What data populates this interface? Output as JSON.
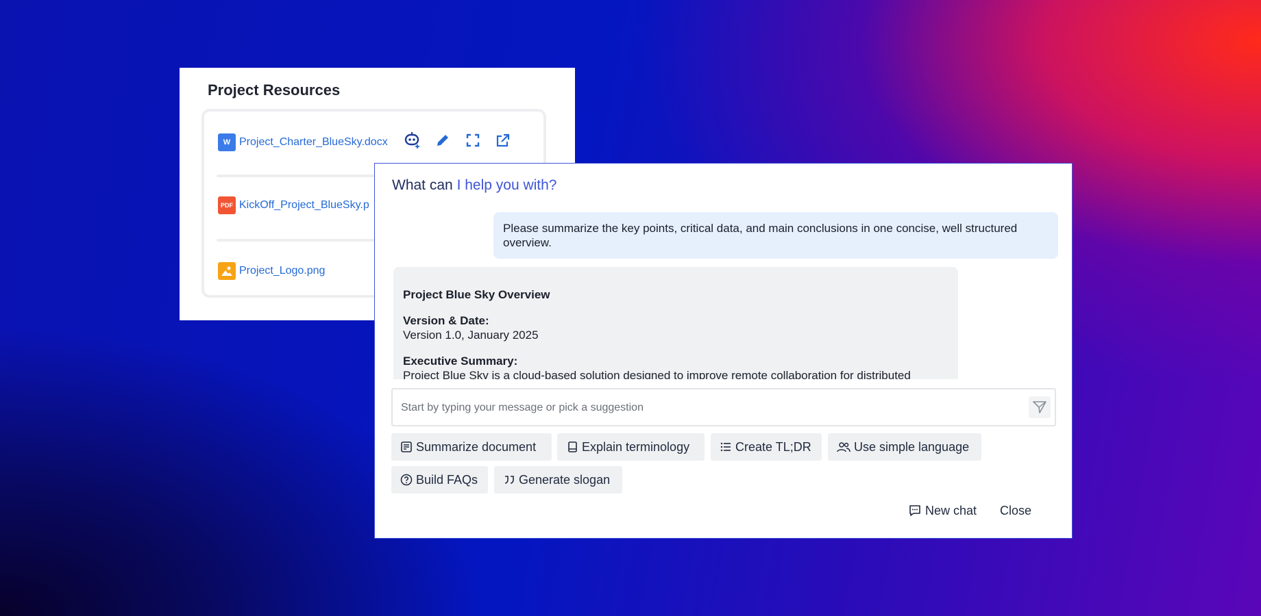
{
  "resources": {
    "title": "Project Resources",
    "files": [
      {
        "name": "Project_Charter_BlueSky.docx",
        "type": "word",
        "icon_label": "W"
      },
      {
        "name": "KickOff_Project_BlueSky.p",
        "type": "pdf",
        "icon_label": "PDF"
      },
      {
        "name": "Project_Logo.png",
        "type": "image"
      }
    ],
    "actions": [
      "ai-assist-icon",
      "edit-icon",
      "expand-icon",
      "open-external-icon"
    ]
  },
  "chat": {
    "title_prefix": "What can",
    "title_accent": "I help you with?",
    "user_message": "Please summarize the key points, critical data, and main conclusions in one concise, well structured overview.",
    "response": {
      "heading": "Project Blue Sky Overview",
      "version_label": "Version & Date:",
      "version_value": "Version 1.0, January 2025",
      "summary_label": "Executive Summary:",
      "summary_text": "Project Blue Sky is a cloud-based solution designed to improve remote collaboration for distributed"
    },
    "input_placeholder": "Start by typing your message or pick a suggestion",
    "suggestions": [
      {
        "label": "Summarize document",
        "icon": "document-icon"
      },
      {
        "label": "Explain terminology",
        "icon": "book-icon"
      },
      {
        "label": "Create TL;DR",
        "icon": "list-icon"
      },
      {
        "label": "Use simple language",
        "icon": "people-icon"
      },
      {
        "label": "Build FAQs",
        "icon": "question-icon"
      },
      {
        "label": "Generate slogan",
        "icon": "quote-icon"
      }
    ],
    "new_chat_label": "New chat",
    "close_label": "Close"
  },
  "colors": {
    "link": "#2469d6",
    "accent": "#3d55d6",
    "dialog_border": "#4053d8",
    "user_bubble": "#e6f0fd",
    "bot_bubble": "#f0f1f3"
  }
}
